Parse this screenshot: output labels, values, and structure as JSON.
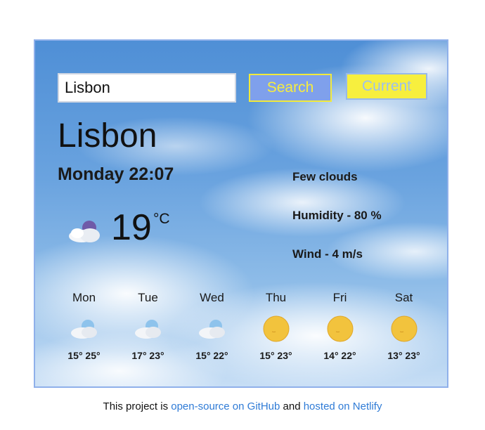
{
  "search": {
    "value": "Lisbon",
    "button_label": "Search",
    "current_label": "Current"
  },
  "current": {
    "city": "Lisbon",
    "datetime": "Monday 22:07",
    "temperature": "19",
    "unit": "°C",
    "icon": "few-clouds-night-icon",
    "description": "Few clouds",
    "humidity": "Humidity - 80 %",
    "wind": "Wind - 4 m/s"
  },
  "forecast": [
    {
      "day": "Mon",
      "temps": "15° 25°",
      "icon": "few-clouds-icon"
    },
    {
      "day": "Tue",
      "temps": "17° 23°",
      "icon": "few-clouds-icon"
    },
    {
      "day": "Wed",
      "temps": "15° 22°",
      "icon": "few-clouds-icon"
    },
    {
      "day": "Thu",
      "temps": "15° 23°",
      "icon": "sun-icon"
    },
    {
      "day": "Fri",
      "temps": "14° 22°",
      "icon": "sun-icon"
    },
    {
      "day": "Sat",
      "temps": "13° 23°",
      "icon": "sun-icon"
    }
  ],
  "footer": {
    "prefix": "This project is ",
    "link1": "open-source on GitHub",
    "middle": " and ",
    "link2": "hosted on Netlify"
  },
  "colors": {
    "card_border": "#8fb0ea",
    "search_button_bg": "#7fa0ec",
    "search_button_text": "#f6ec3f",
    "current_button_bg": "#f7ef3e",
    "current_button_text": "#9cc0ee",
    "link": "#2f7bd6"
  }
}
